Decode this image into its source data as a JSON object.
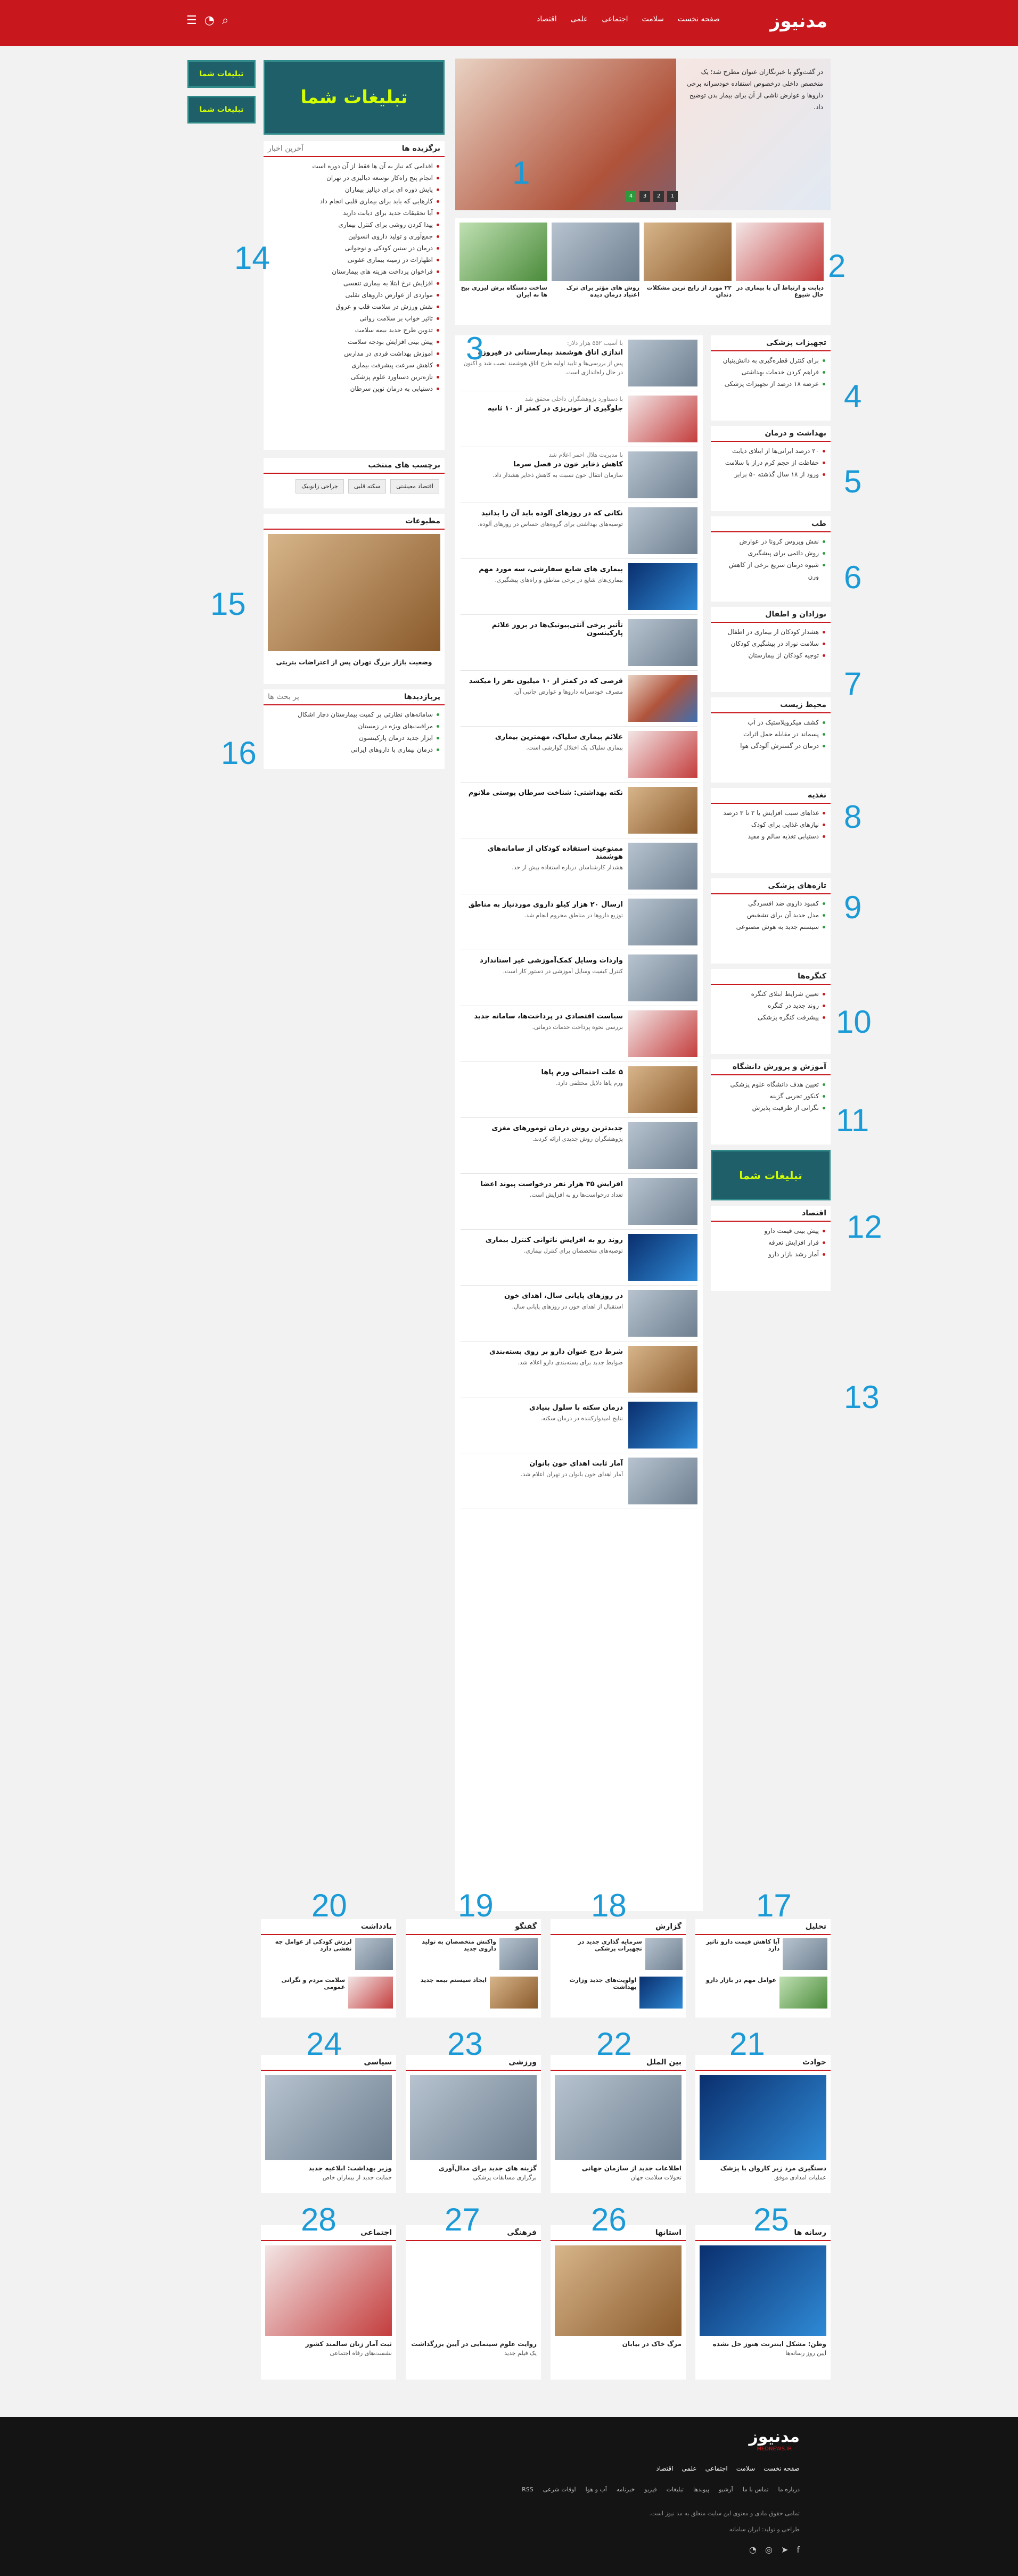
{
  "header": {
    "logo": "مدنیوز",
    "nav": [
      "صفحه نخست",
      "سلامت",
      "اجتماعی",
      "علمی",
      "اقتصاد"
    ],
    "icons": [
      "search-icon",
      "rss-icon",
      "menu-icon"
    ]
  },
  "callouts": [
    "1",
    "2",
    "3",
    "4",
    "5",
    "6",
    "7",
    "8",
    "9",
    "10",
    "11",
    "12",
    "13",
    "14",
    "15",
    "16",
    "17",
    "18",
    "19",
    "20",
    "21",
    "22",
    "23",
    "24",
    "25",
    "26",
    "27",
    "28"
  ],
  "slider": {
    "summary": "در گفت‌وگو با خبرنگاران عنوان مطرح شد؛ یک متخصص داخلی درخصوص استفاده خودسرانه برخی داروها و عوارض ناشی از آن برای بیمار بدن توضیح داد.",
    "controls": [
      "1",
      "2",
      "3",
      "4"
    ]
  },
  "ad": {
    "label": "تبلیغات شما"
  },
  "strip": [
    {
      "title": "ساخت دستگاه برش لیزری بیخ ها به ایران"
    },
    {
      "title": "روش های مؤثر برای ترک اعتیاد درمان دیده"
    },
    {
      "title": "۲۲ مورد از رایج ترین مشکلات دندان"
    },
    {
      "title": "دیابت و ارتباط آن با بیماری در حال شیوع"
    }
  ],
  "right_col": [
    {
      "title": "تجهیزات پزشکی",
      "items": [
        "برای کنترل قطره‌گیری به دانش‌بنیان",
        "فراهم کردن خدمات بهداشتی",
        "عرضه ۱۸ درصد از تجهیزات پزشکی"
      ]
    },
    {
      "title": "بهداشت و درمان",
      "items": [
        "۲۰ درصد ایرانی‌ها از ابتلای دیابت",
        "حفاظت از حجم کرم دراز با سلامت",
        "ورود از ۱۸ سال گذشته ۵۰ برابر"
      ]
    },
    {
      "title": "طب",
      "items": [
        "نقش ویروس کرونا در عوارض",
        "روش دائمی برای پیشگیری",
        "شیوه درمان سریع برخی از کاهش ورن"
      ]
    },
    {
      "title": "نوزادان و اطفال",
      "items": [
        "هشدار کودکان از بیماری در اطفال",
        "سلامت نوزاد در پیشگیری کودکان",
        "توجیه کودکان از بیمارستان"
      ]
    },
    {
      "title": "محیط زیست",
      "items": [
        "کشف میکروپلاستیک در آب",
        "پسماند در مقابله حمل اثرات",
        "درمان در گسترش آلودگی هوا"
      ]
    },
    {
      "title": "تغذیه",
      "items": [
        "غذاهای سبب افزایش یا ۲ تا ۳ درصد",
        "نیازهای غذایی برای کودک",
        "دستیابی تغذیه سالم و مفید"
      ]
    },
    {
      "title": "تازه‌های پزشکی",
      "items": [
        "کمبود داروی ضد افسردگی",
        "مدل جدید آن برای تشخیص",
        "سیستم جدید به هوش مصنوعی"
      ]
    },
    {
      "title": "کنگره‌ها",
      "items": [
        "تعیین شرایط ابتلای کنگره",
        "روند جدید در کنگره",
        "پیشرفت کنگره پزشکی"
      ]
    },
    {
      "title": "آموزش و پرورش دانشگاه",
      "items": [
        "تعیین هدف دانشگاه علوم پزشکی",
        "کنکور تجربی گزینه",
        "نگرانی از ظرفیت پذیرش"
      ]
    },
    {
      "title": "اقتصاد",
      "items": [
        "پیش بینی قیمت دارو",
        "فرار افزایش تعرفه",
        "آمار رشد بازار دارو"
      ]
    }
  ],
  "center_news": [
    {
      "pre": "با آسیب ۵۵۲ هزار دلار:",
      "ttl": "اندازی اتاق هوشمند بیمارستانی در فیروزه",
      "sum": "پس از بررسی‌ها و تایید اولیه طرح اتاق هوشمند نصب شد و اکنون در حال راه‌اندازی است."
    },
    {
      "pre": "با دستاورد پژوهشگران داخلی محقق شد",
      "ttl": "جلوگیری از خونریزی در کمتر از ۱۰ ثانیه",
      "sum": ""
    },
    {
      "pre": "با مدیریت هلال احمر اعلام شد",
      "ttl": "کاهش ذخایر خون در فصل سرما",
      "sum": "سازمان انتقال خون نسبت به کاهش ذخایر هشدار داد."
    },
    {
      "pre": "",
      "ttl": "نکاتی که در روزهای آلوده باید آن را بدانید",
      "sum": "توصیه‌های بهداشتی برای گروه‌های حساس در روزهای آلوده."
    },
    {
      "pre": "",
      "ttl": "بیماری های شایع سفارشی، سه مورد مهم",
      "sum": "بیماری‌های شایع در برخی مناطق و راه‌های پیشگیری."
    },
    {
      "pre": "",
      "ttl": "تأثیر برخی آنتی‌بیوتیک‌ها در بروز علائم پارکینسون",
      "sum": ""
    },
    {
      "pre": "",
      "ttl": "قرصی که در کمتر از ۱۰ میلیون نفر را میکشد",
      "sum": "مصرف خودسرانه داروها و عوارض جانبی آن."
    },
    {
      "pre": "",
      "ttl": "علائم بیماری سلیاک، مهمترین بیماری",
      "sum": "بیماری سلیاک یک اختلال گوارشی است."
    },
    {
      "pre": "",
      "ttl": "نکته بهداشتی: شناخت سرطان پوستی ملانوم",
      "sum": ""
    },
    {
      "pre": "",
      "ttl": "ممنوعیت استفاده کودکان از سامانه‌های هوشمند",
      "sum": "هشدار کارشناسان درباره استفاده بیش از حد."
    },
    {
      "pre": "",
      "ttl": "ارسال ۲۰ هزار کیلو داروی موردنیاز به مناطق",
      "sum": "توزیع داروها در مناطق محروم انجام شد."
    },
    {
      "pre": "",
      "ttl": "واردات وسایل کمک‌آموزشی غیر استاندارد",
      "sum": "کنترل کیفیت وسایل آموزشی در دستور کار است."
    },
    {
      "pre": "",
      "ttl": "سیاست اقتصادی در پرداخت‌ها، سامانه جدید",
      "sum": "بررسی نحوه پرداخت خدمات درمانی."
    },
    {
      "pre": "",
      "ttl": "۵ علت احتمالی ورم پاها",
      "sum": "ورم پاها دلایل مختلفی دارد."
    },
    {
      "pre": "",
      "ttl": "جدیدترین روش درمان تومورهای مغزی",
      "sum": "پژوهشگران روش جدیدی ارائه کردند."
    },
    {
      "pre": "",
      "ttl": "افزایش ۳۵ هزار نفر درخواست پیوند اعضا",
      "sum": "تعداد درخواست‌ها رو به افزایش است."
    },
    {
      "pre": "",
      "ttl": "روند رو به افزایش ناتوانی کنترل بیماری",
      "sum": "توصیه‌های متخصصان برای کنترل بیماری."
    },
    {
      "pre": "",
      "ttl": "در روزهای پایانی سال، اهدای خون",
      "sum": "استقبال از اهدای خون در روزهای پایانی سال."
    },
    {
      "pre": "",
      "ttl": "شرط درج عنوان دارو بر روی بسته‌بندی",
      "sum": "ضوابط جدید برای بسته‌بندی دارو اعلام شد."
    },
    {
      "pre": "",
      "ttl": "درمان سکته با سلول بنیادی",
      "sum": "نتایج امیدوارکننده در درمان سکته."
    },
    {
      "pre": "",
      "ttl": "آمار ثابت اهدای خون بانوان",
      "sum": "آمار اهدای خون بانوان در تهران اعلام شد."
    }
  ],
  "left_col": {
    "tabs": [
      "برگزیده ها",
      "آخرین اخبار"
    ],
    "featured": [
      "اقدامی که نیاز به آن ها فقط از آن دوره است",
      "انجام پنج راه‌کار توسعه دیالیزی در تهران",
      "پایش دوره ای برای دیالیز بیماران",
      "کارهایی که باید برای بیماری قلبی انجام داد",
      "آیا تحقیقات جدید برای دیابت دارید",
      "پیدا کردن روشی برای کنترل بیماری",
      "جمع‌آوری و تولید داروی انسولین",
      "درمان در سنین کودکی و نوجوانی",
      "اظهارات در زمینه بیماری عفونی",
      "فراخوان پرداخت هزینه های بیمارستان",
      "افزایش نرخ ابتلا به بیماری تنفسی",
      "مواردی از عوارض داروهای تقلبی",
      "نقش ورزش در سلامت قلب و عروق",
      "تاثیر خواب بر سلامت روانی",
      "تدوین طرح جدید بیمه سلامت",
      "پیش بینی افزایش بودجه سلامت",
      "آموزش بهداشت فردی در مدارس",
      "کاهش سرعت پیشرفت بیماری",
      "تازه‌ترین دستاورد علوم پزشکی",
      "دستیابی به درمان نوین سرطان"
    ],
    "tags_title": "برچسب های منتخب",
    "tags": [
      "اقتصاد معیشتی",
      "سکته قلبی",
      "جراحی زانوبیک"
    ],
    "photo_title": "مطبوعات",
    "photo_caption": "وضعیت بازار بزرگ تهران پس از اعتراضات بتریتی",
    "most_tabs": [
      "پربازدیدها",
      "پر بحث ها"
    ],
    "most": [
      "سامانه‌های نظارتی بر کمیت بیمارستان دچار اشکال",
      "مراقبت‌های ویژه در زمستان",
      "ابزار جدید درمان پارکینسون",
      "درمان بیماری با داروهای ایرانی"
    ]
  },
  "categories_row1": [
    {
      "title": "یادداشت",
      "items": [
        "لرزش کودکی از عوامل چه نقشی دارد",
        "سلامت مردم و نگرانی عمومی"
      ]
    },
    {
      "title": "گفتگو",
      "items": [
        "واکنش متخصصان به تولید داروی جدید",
        "ایجاد سیستم بیمه جدید"
      ]
    },
    {
      "title": "گزارش",
      "items": [
        "سرمایه گذاری جدید در تجهیزات پزشکی",
        "اولویت‌های جدید وزارت بهداشت"
      ]
    },
    {
      "title": "تحلیل",
      "items": [
        "آیا کاهش قیمت دارو تاثیر دارد",
        "عوامل مهم در بازار دارو"
      ]
    }
  ],
  "categories_row2": [
    {
      "title": "سیاسی",
      "cap": "وزیر بهداشت: ابلاغیه جدید",
      "items": [
        "حمایت جدید از بیماران خاص"
      ]
    },
    {
      "title": "ورزشی",
      "cap": "گزینه های جدید برای مدال‌آوری",
      "items": [
        "برگزاری مسابقات پزشکی"
      ]
    },
    {
      "title": "بین الملل",
      "cap": "اطلاعات جدید از سازمان جهانی",
      "items": [
        "تحولات سلامت جهان"
      ]
    },
    {
      "title": "حوادث",
      "cap": "دستگیری مرد زیر کاروان با پزشک",
      "items": [
        "عملیات امدادی موفق"
      ]
    }
  ],
  "categories_row3": [
    {
      "title": "اجتماعی",
      "cap": "ثبت آمار زنان سالمند کشور",
      "items": [
        "نشست‌های رفاه اجتماعی"
      ]
    },
    {
      "title": "فرهنگی",
      "cap": "روایت علوم سینمایی در آیین بزرگداشت",
      "items": [
        "یک فیلم جدید"
      ]
    },
    {
      "title": "استانها",
      "cap": "مرگ خاک در بیابان",
      "items": []
    },
    {
      "title": "رسانه ها",
      "cap": "وطن: مشکل اینترنت هنوز حل نشده",
      "items": [
        "آیین روز رسانه‌ها"
      ]
    }
  ],
  "footer": {
    "logo": "مدنیوز",
    "domain": "MEDNEWS.IR",
    "nav": [
      "صفحه نخست",
      "سلامت",
      "اجتماعی",
      "علمی",
      "اقتصاد"
    ],
    "links": [
      "درباره ما",
      "تماس با ما",
      "آرشیو",
      "پیوندها",
      "تبلیغات",
      "فیزیو",
      "خبرنامه",
      "آب و هوا",
      "اوقات شرعی",
      "RSS"
    ],
    "copyright": "تمامی حقوق مادی و معنوی این سایت متعلق به مد نیوز است.",
    "credit": "طراحی و تولید: ایران سامانه",
    "icons": [
      "facebook-icon",
      "telegram-icon",
      "instagram-icon",
      "rss-icon"
    ]
  }
}
